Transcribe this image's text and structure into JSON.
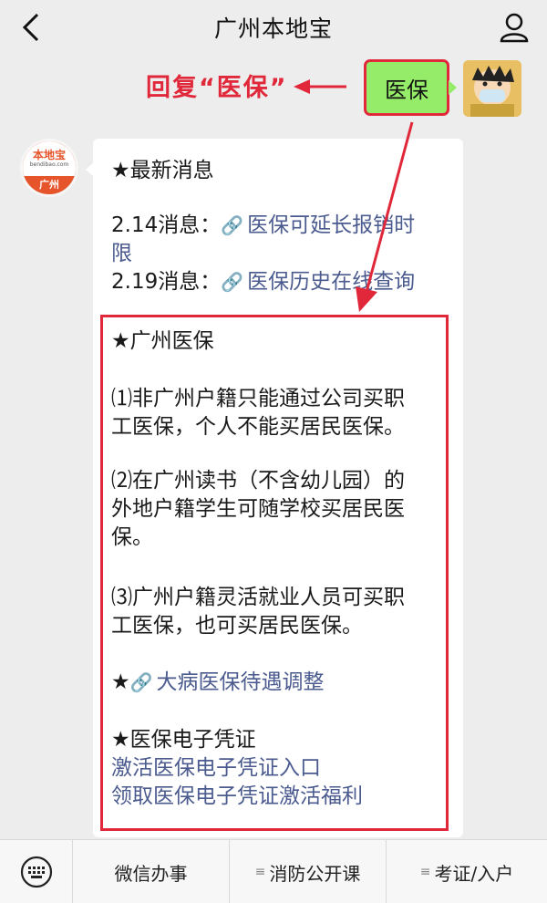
{
  "header": {
    "title": "广州本地宝",
    "back_icon": "chevron-left-icon",
    "profile_icon": "user-icon"
  },
  "annotation": {
    "text": "回复“医保”",
    "color": "#e0283a"
  },
  "sent_message": {
    "text": "医保",
    "bubble_color": "#95ec69"
  },
  "bot": {
    "avatar_brand": "本地宝",
    "avatar_site": "bendibao.com",
    "avatar_city": "广州"
  },
  "card": {
    "section1_title": "★最新消息",
    "news1_prefix": "2.14消息：",
    "news1_link_line1": "医保可延长报销时",
    "news1_link_line2": "限",
    "news2_prefix": "2.19消息：",
    "news2_link": "医保历史在线查询",
    "section2_title": "★广州医保",
    "item1_line1": "⑴非广州户籍只能通过公司买职",
    "item1_line2": "工医保，个人不能买居民医保。",
    "item2_line1": "⑵在广州读书（不含幼儿园）的",
    "item2_line2": "外地户籍学生可随学校买居民医",
    "item2_line3": "保。",
    "item3_line1": "⑶广州户籍灵活就业人员可买职",
    "item3_line2": "工医保，也可买居民医保。",
    "section3_star": "★",
    "section3_link": "大病医保待遇调整",
    "section4_title": "★医保电子凭证",
    "section4_link1": "激活医保电子凭证入口",
    "section4_link2": "领取医保电子凭证激活福利",
    "link_color": "#4b5b8f"
  },
  "bottom_bar": {
    "keyboard_icon": "keyboard-icon",
    "menu1": "微信办事",
    "menu2": "消防公开课",
    "menu3": "考证/入户"
  }
}
